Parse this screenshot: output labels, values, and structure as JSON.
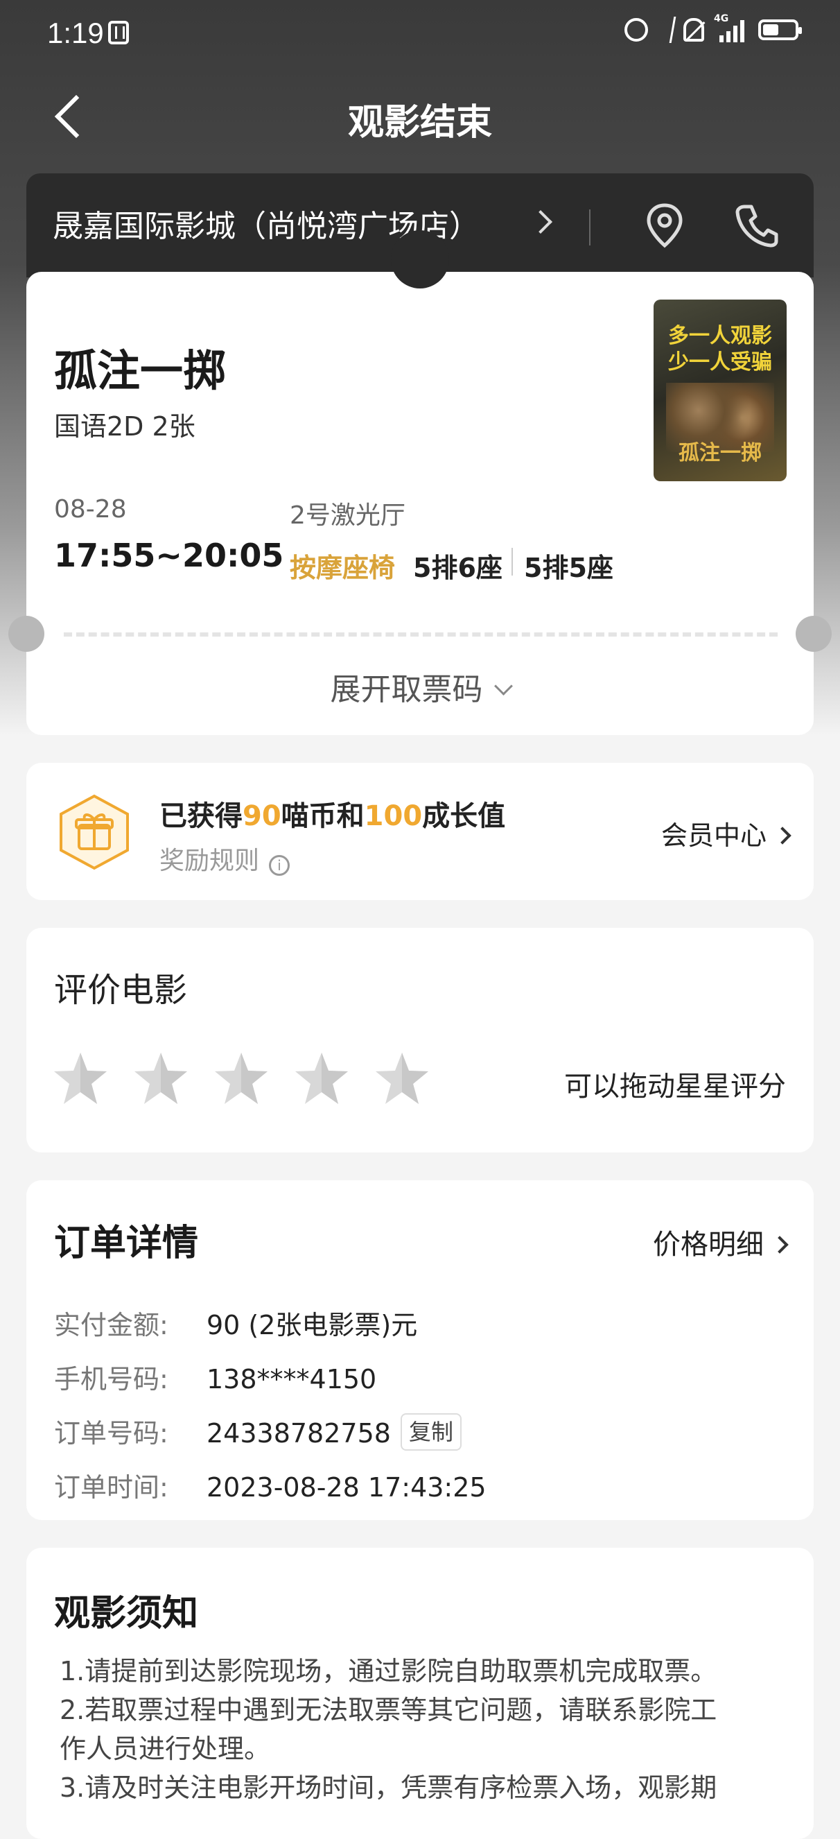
{
  "status_bar": {
    "time": "1:19",
    "network": "4G"
  },
  "nav": {
    "title": "观影结束"
  },
  "cinema": {
    "name": "晟嘉国际影城（尚悦湾广场店）"
  },
  "ticket": {
    "movie_title": "孤注一掷",
    "format": "国语2D 2张",
    "poster_tagline_1": "多一人观影",
    "poster_tagline_2": "少一人受骗",
    "poster_logo": "孤注一掷",
    "date": "08-28",
    "time": "17:55~20:05",
    "hall": "2号激光厅",
    "seat_type": "按摩座椅",
    "seats": [
      "5排6座",
      "5排5座"
    ],
    "expand_label": "展开取票码"
  },
  "reward": {
    "prefix": "已获得",
    "coins": "90",
    "mid": "喵币和",
    "growth": "100",
    "suffix": "成长值",
    "rule_label": "奖励规则",
    "member_link": "会员中心",
    "accent_color": "#f0a830"
  },
  "rating": {
    "title": "评价电影",
    "stars": 0,
    "max_stars": 5,
    "hint": "可以拖动星星评分"
  },
  "order": {
    "title": "订单详情",
    "price_link": "价格明细",
    "rows": [
      {
        "label": "实付金额:",
        "value": "90 (2张电影票)元"
      },
      {
        "label": "手机号码:",
        "value": "138****4150"
      },
      {
        "label": "订单号码:",
        "value": "24338782758"
      },
      {
        "label": "订单时间:",
        "value": "2023-08-28 17:43:25"
      }
    ],
    "copy_label": "复制"
  },
  "notice": {
    "title": "观影须知",
    "lines": [
      "1.请提前到达影院现场，通过影院自助取票机完成取票。",
      "2.若取票过程中遇到无法取票等其它问题，请联系影院工",
      "作人员进行处理。",
      "3.请及时关注电影开场时间，凭票有序检票入场，观影期"
    ]
  }
}
